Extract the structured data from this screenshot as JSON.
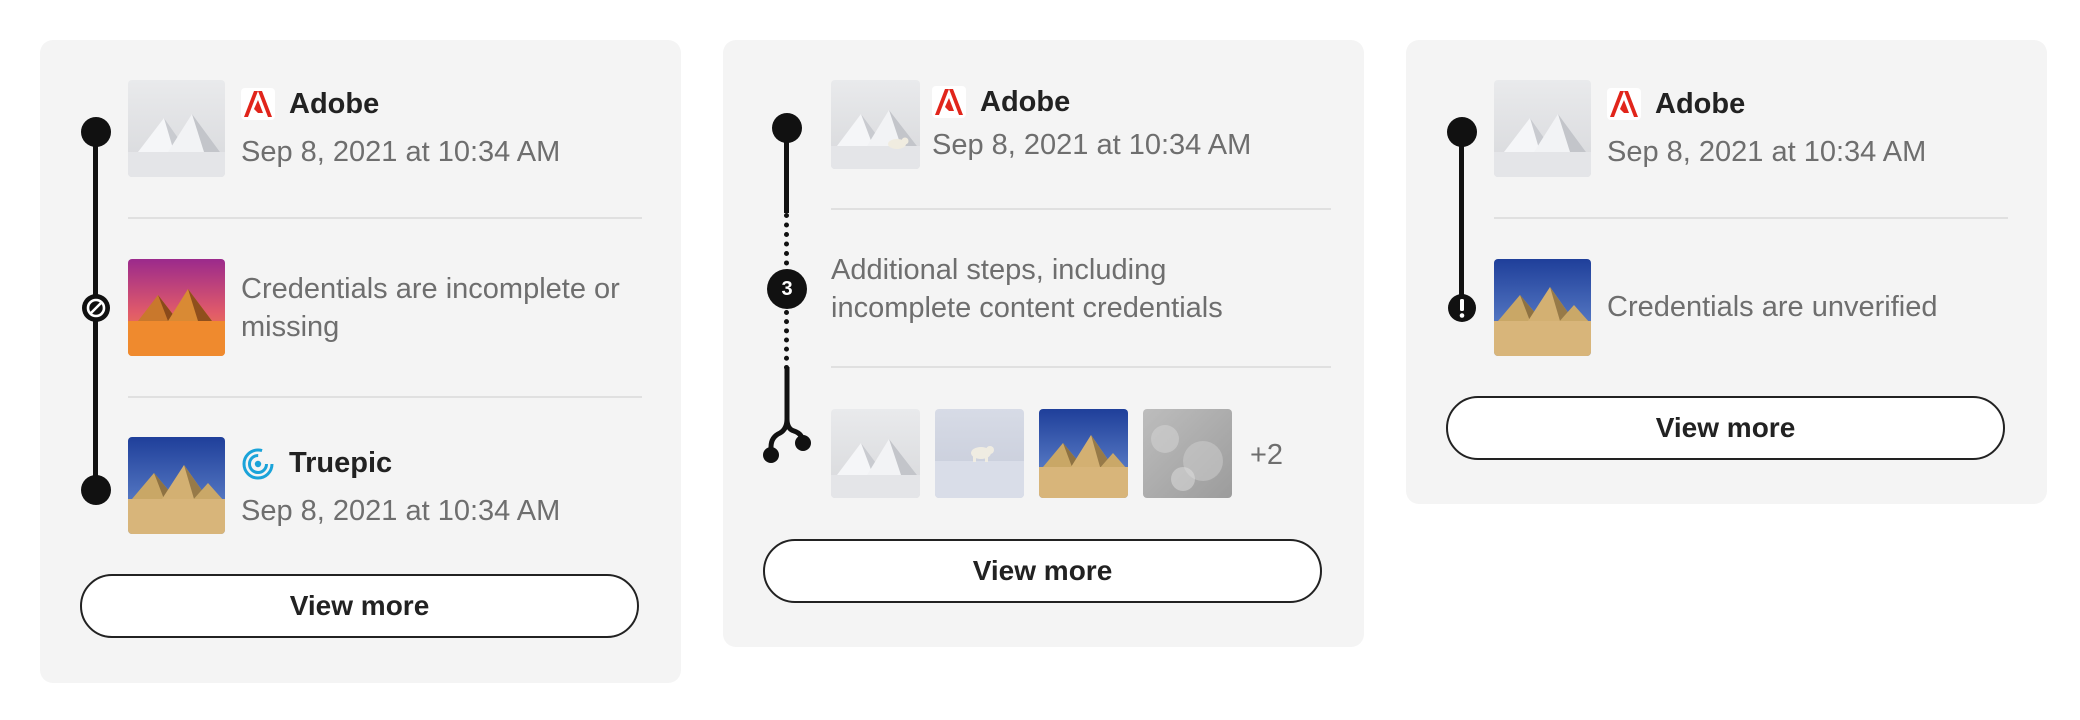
{
  "cards": [
    {
      "steps": [
        {
          "issuer": "Adobe",
          "issuer_icon": "adobe-logo-icon",
          "date": "Sep 8, 2021 at 10:34 AM",
          "thumbnail": "snowy-mountains"
        },
        {
          "message": "Credentials are incomplete or missing",
          "status_icon": "incomplete-icon",
          "thumbnail": "pyramids-sunset"
        },
        {
          "issuer": "Truepic",
          "issuer_icon": "truepic-logo-icon",
          "date": "Sep 8, 2021 at 10:34 AM",
          "thumbnail": "pyramids-blue-sky"
        }
      ],
      "button_label": "View more"
    },
    {
      "steps": [
        {
          "issuer": "Adobe",
          "issuer_icon": "adobe-logo-icon",
          "date": "Sep 8, 2021 at 10:34 AM",
          "thumbnail": "snowy-mountains-bear"
        },
        {
          "badge_count": "3",
          "message": "Additional steps, including incomplete content credentials"
        }
      ],
      "ingredients": {
        "thumbnails": [
          "snowy-mountains",
          "polar-bear",
          "pyramids-blue-sky",
          "snow-texture"
        ],
        "more_label": "+2"
      },
      "button_label": "View more"
    },
    {
      "steps": [
        {
          "issuer": "Adobe",
          "issuer_icon": "adobe-logo-icon",
          "date": "Sep 8, 2021 at 10:34 AM",
          "thumbnail": "snowy-mountains"
        },
        {
          "message": "Credentials are unverified",
          "status_icon": "alert-icon",
          "thumbnail": "pyramids-blue-sky"
        }
      ],
      "button_label": "View more"
    }
  ],
  "colors": {
    "card_bg": "#f4f4f4",
    "adobe_red": "#e1251b",
    "truepic_blue": "#1aa3d9",
    "timeline": "#111111",
    "secondary_text": "#6e6e6e"
  }
}
